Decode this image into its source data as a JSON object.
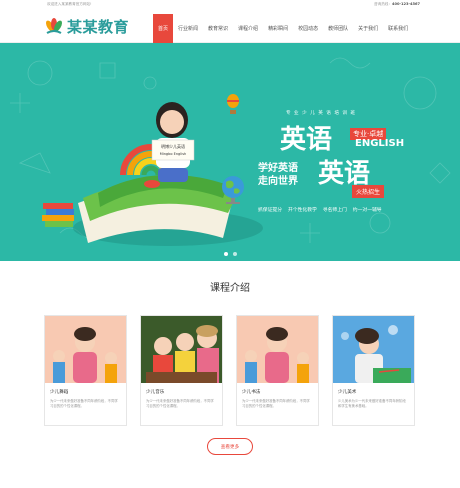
{
  "header": {
    "welcome_text": "欢迎进入某某教育官方网站!",
    "hotline_label": "咨询热线：",
    "hotline_number": "400-123-4567",
    "logo_text": "某某教育"
  },
  "nav": {
    "items": [
      {
        "label": "首页",
        "active": true
      },
      {
        "label": "行业新闻"
      },
      {
        "label": "教育常识"
      },
      {
        "label": "课程介绍"
      },
      {
        "label": "精彩瞬间"
      },
      {
        "label": "校园动态"
      },
      {
        "label": "教师团队"
      },
      {
        "label": "关于我们"
      },
      {
        "label": "联系我们"
      }
    ]
  },
  "banner": {
    "vertical_caption": "专 业 少 儿 英 语 培 训 班",
    "headline_1": "英语",
    "headline_2": "英语",
    "tag_pro": "专业·卓越",
    "english": "ENGLISH",
    "slogan_1": "学好英语",
    "slogan_2": "走向世界",
    "enroll": "火热招生",
    "features": [
      "抓保证提分",
      "开个性化教学",
      "寻名师上门",
      "约一对一辅导"
    ],
    "sign_text_1": "明博少儿英语",
    "sign_text_2": "Mingbo English"
  },
  "courses": {
    "section_title": "课程介绍",
    "items": [
      {
        "title": "少儿舞蹈",
        "desc": "为少一代未来做好准备不同年龄阶段，不同学习目的的个性化课程。"
      },
      {
        "title": "少儿音乐",
        "desc": "为少一代未来做好准备不同年龄阶段，不同学习目的的个性化课程。"
      },
      {
        "title": "少儿书法",
        "desc": "为少一代未来做好准备不同年龄阶段，不同学习目的的个性化课程。"
      },
      {
        "title": "少儿美术",
        "desc": "少儿美术为少一代未来做好准备不同年龄阶段和学生有美术基础。"
      }
    ],
    "more_label": "查看更多"
  }
}
